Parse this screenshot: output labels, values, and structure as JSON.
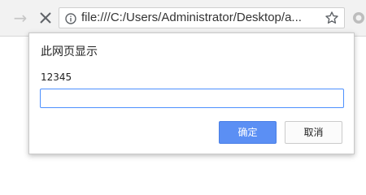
{
  "browser": {
    "forward_glyph": "→",
    "address_url": "file:///C:/Users/Administrator/Desktop/a...",
    "colors": {
      "toolbar": "#f2f2f2",
      "ok_button": "#5b8ff4",
      "input_focus": "#4d90fe"
    }
  },
  "dialog": {
    "title": "此网页显示",
    "message": "12345",
    "input_value": "",
    "ok_label": "确定",
    "cancel_label": "取消"
  }
}
